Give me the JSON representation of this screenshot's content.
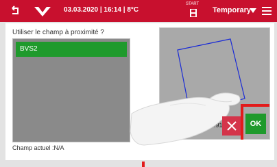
{
  "header": {
    "datetime": "03.03.2020 | 16:14 | 8°C",
    "start_label": "START",
    "mode": "Temporary",
    "colors": {
      "bar": "#c8102e"
    }
  },
  "dialog": {
    "prompt": "Utiliser le champ à proximité ?",
    "list_items": [
      {
        "label": "BVS2",
        "selected": true
      }
    ],
    "map_area": "0.91 ha",
    "current_field": "Champ actuel :N/A",
    "ok_label": "OK"
  },
  "icons": [
    "back-icon",
    "brand-logo-icon",
    "save-disk-icon",
    "chevron-down-icon",
    "menu-icon",
    "close-icon"
  ]
}
